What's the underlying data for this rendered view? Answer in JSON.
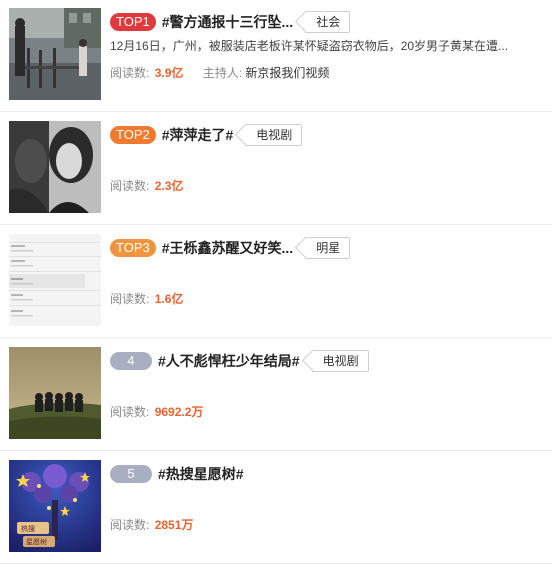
{
  "labels": {
    "read_count": "阅读数:",
    "host": "主持人:"
  },
  "items": [
    {
      "rank": "TOP1",
      "title": "#警方通报十三行坠...",
      "tag": "社会",
      "desc": "12月16日，广州，被服装店老板许某怀疑盗窃衣物后，20岁男子黄某在遭...",
      "reads": "3.9亿",
      "host": "新京报我们视频"
    },
    {
      "rank": "TOP2",
      "title": "#萍萍走了#",
      "tag": "电视剧",
      "desc": "",
      "reads": "2.3亿",
      "host": ""
    },
    {
      "rank": "TOP3",
      "title": "#王栎鑫苏醒又好笑...",
      "tag": "明星",
      "desc": "",
      "reads": "1.6亿",
      "host": ""
    },
    {
      "rank": "4",
      "title": "#人不彪悍枉少年结局#",
      "tag": "电视剧",
      "desc": "",
      "reads": "9692.2万",
      "host": ""
    },
    {
      "rank": "5",
      "title": "#热搜星愿树#",
      "tag": "",
      "desc": "",
      "reads": "2851万",
      "host": ""
    }
  ],
  "thumbs": {
    "tree_sign_text_1": "热搜",
    "tree_sign_text_2": "星愿树"
  },
  "colors": {
    "top1": "#e0393e",
    "top2": "#f07a2d",
    "top3": "#f0953d",
    "rank_gray": "#a8afc1",
    "count": "#e8632f"
  }
}
